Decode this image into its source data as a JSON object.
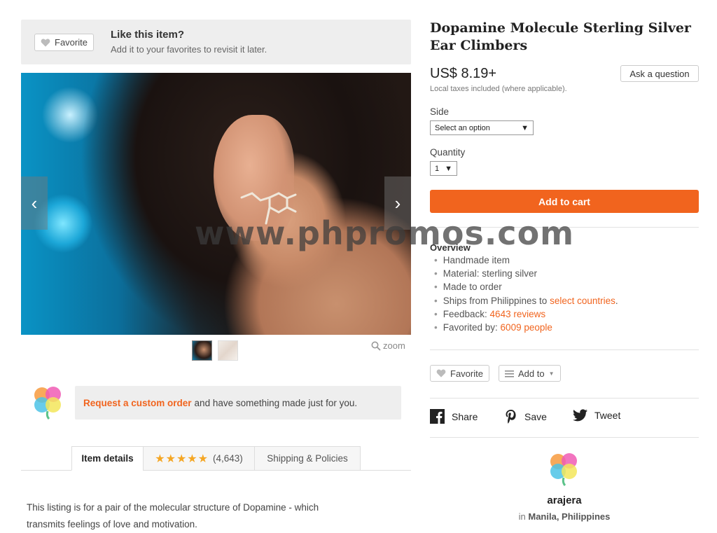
{
  "favorite_banner": {
    "button_label": "Favorite",
    "title": "Like this item?",
    "subtitle": "Add it to your favorites to revisit it later."
  },
  "gallery": {
    "prev_arrow": "‹",
    "next_arrow": "›",
    "zoom_label": "zoom",
    "thumbnail_count": 2
  },
  "custom_order": {
    "link_text": "Request a custom order",
    "rest_text": "and have something made just for you."
  },
  "tabs": [
    {
      "label": "Item details"
    },
    {
      "stars": "★★★★★",
      "count": "(4,643)"
    },
    {
      "label": "Shipping & Policies"
    }
  ],
  "description": {
    "line1": "This listing is for a pair of the molecular structure of Dopamine - which",
    "line2": "transmits feelings of love and motivation."
  },
  "listing": {
    "title": "Dopamine Molecule Sterling Silver Ear Climbers",
    "price": "US$ 8.19+",
    "tax_note": "Local taxes included (where applicable).",
    "ask_button": "Ask a question",
    "side_label": "Side",
    "side_value": "Select an option",
    "quantity_label": "Quantity",
    "quantity_value": "1",
    "add_to_cart": "Add to cart"
  },
  "overview": {
    "title": "Overview",
    "handmade": "Handmade item",
    "material": "Material: sterling silver",
    "made_to_order": "Made to order",
    "ships_prefix": "Ships from Philippines to",
    "ships_link": "select countries",
    "ships_suffix": ".",
    "feedback_prefix": "Feedback:",
    "feedback_link": "4643 reviews",
    "favorited_prefix": "Favorited by:",
    "favorited_link": "6009 people"
  },
  "actions": {
    "favorite": "Favorite",
    "add_to": "Add to"
  },
  "social": {
    "share": "Share",
    "save": "Save",
    "tweet": "Tweet"
  },
  "shop": {
    "name": "arajera",
    "location_prefix": "in",
    "location": "Manila, Philippines"
  },
  "watermark": "www.phpromos.com",
  "colors": {
    "accent": "#f1641e",
    "star": "#f5a623",
    "banner_bg": "#eeeeee"
  }
}
